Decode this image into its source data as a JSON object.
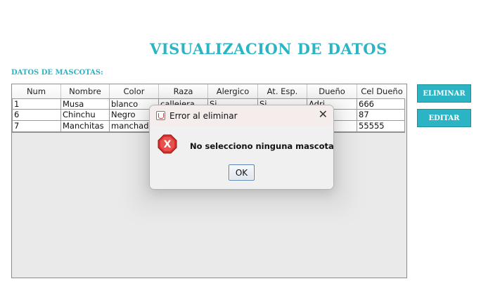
{
  "window": {
    "title": "",
    "controls": {
      "minimize": "—",
      "maximize": "",
      "close": "✕"
    }
  },
  "page": {
    "title": "VISUALIZACION DE DATOS",
    "section_label": "DATOS DE MASCOTAS:"
  },
  "table": {
    "columns": [
      "Num",
      "Nombre",
      "Color",
      "Raza",
      "Alergico",
      "At. Esp.",
      "Dueño",
      "Cel Dueño"
    ],
    "rows": [
      [
        "1",
        "Musa",
        "blanco",
        "callejera",
        "Si",
        "Si",
        "Adri",
        "666"
      ],
      [
        "6",
        "Chinchu",
        "Negro",
        "",
        "",
        "",
        "",
        "87"
      ],
      [
        "7",
        "Manchitas",
        "manchado",
        "",
        "",
        "",
        "",
        "55555"
      ]
    ]
  },
  "buttons": {
    "eliminar": "ELIMINAR",
    "editar": "EDITAR"
  },
  "dialog": {
    "title": "Error al eliminar",
    "message": "No selecciono ninguna mascota",
    "ok": "OK",
    "close": "✕"
  },
  "colors": {
    "accent": "#2bb5c4",
    "error": "#d9302e"
  },
  "icons": {
    "app": "java-cup-icon",
    "dialog_app": "java-cup-icon",
    "error": "error-x-icon"
  }
}
